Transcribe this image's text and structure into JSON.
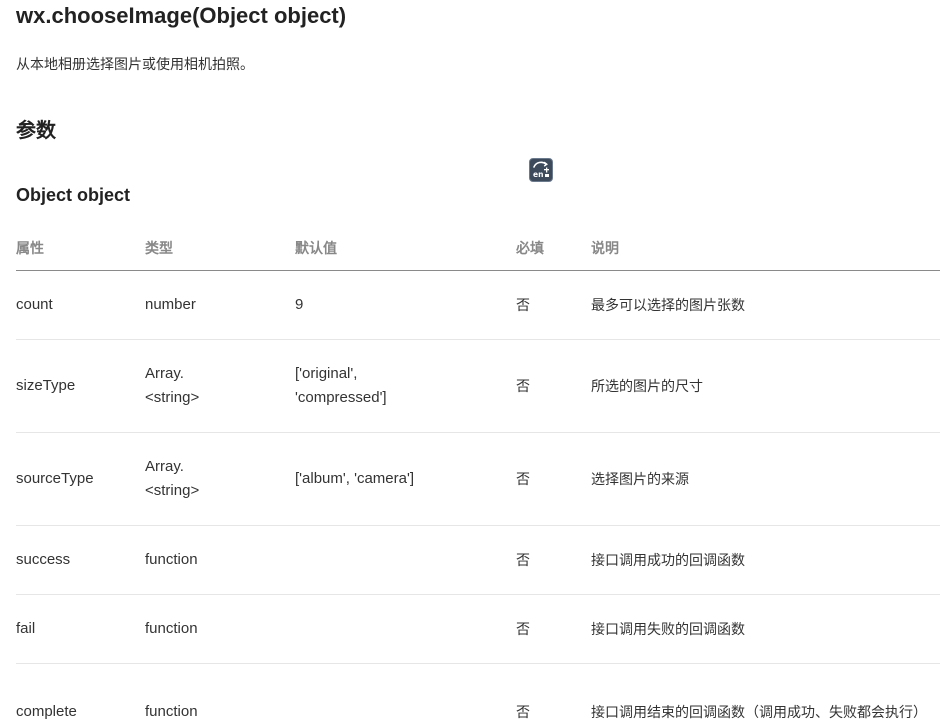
{
  "page": {
    "title": "wx.chooseImage(Object object)",
    "description": "从本地相册选择图片或使用相机拍照。",
    "section_params": "参数",
    "section_object": "Object object"
  },
  "translate_button": {
    "icon": "translate-icon",
    "glyph_text": "en",
    "colors": {
      "background": "#3c4a5c",
      "foreground": "#ffffff"
    }
  },
  "table": {
    "headers": [
      "属性",
      "类型",
      "默认值",
      "必填",
      "说明"
    ],
    "rows": [
      {
        "name": "count",
        "type": "number",
        "default": "9",
        "required": "否",
        "description": "最多可以选择的图片张数"
      },
      {
        "name": "sizeType",
        "type": "Array.<string>",
        "default": "['original', 'compressed']",
        "required": "否",
        "description": "所选的图片的尺寸"
      },
      {
        "name": "sourceType",
        "type": "Array.<string>",
        "default": "['album', 'camera']",
        "required": "否",
        "description": "选择图片的来源"
      },
      {
        "name": "success",
        "type": "function",
        "default": "",
        "required": "否",
        "description": "接口调用成功的回调函数"
      },
      {
        "name": "fail",
        "type": "function",
        "default": "",
        "required": "否",
        "description": "接口调用失败的回调函数"
      },
      {
        "name": "complete",
        "type": "function",
        "default": "",
        "required": "否",
        "description": "接口调用结束的回调函数（调用成功、失败都会执行）"
      }
    ]
  }
}
